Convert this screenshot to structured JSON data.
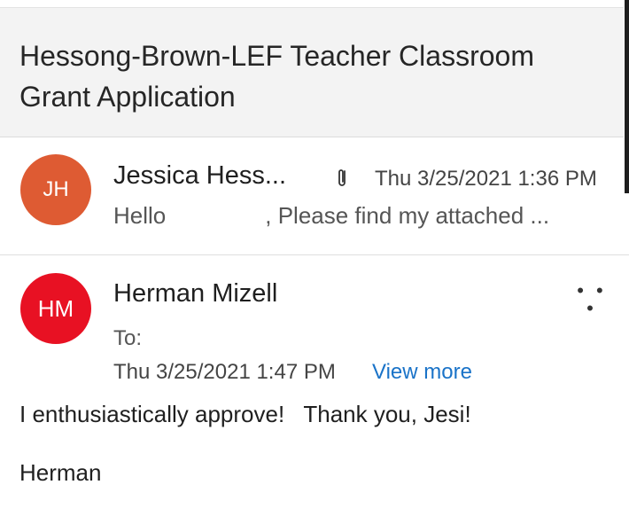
{
  "subject": {
    "line1": "Hessong-Brown-LEF Teacher Classroom",
    "line2": "Grant Application"
  },
  "thread": [
    {
      "initials": "JH",
      "avatar_color": "#de5b33",
      "sender": "Jessica Hess...",
      "attachment_icon": "paperclip-icon",
      "time": "Thu 3/25/2021 1:36 PM",
      "preview_start": "Hello",
      "preview_end": ", Please find my attached ..."
    },
    {
      "initials": "HM",
      "avatar_color": "#e81123",
      "sender": "Herman Mizell",
      "more_label": "• • •",
      "to_label": "To:",
      "time": "Thu 3/25/2021 1:47 PM",
      "view_more": "View more",
      "body_line1": "I enthusiastically approve!   Thank you, Jesi!",
      "body_line2": "Herman"
    }
  ],
  "colors": {
    "link": "#1a73c8",
    "subject_bg": "#f3f3f3"
  }
}
